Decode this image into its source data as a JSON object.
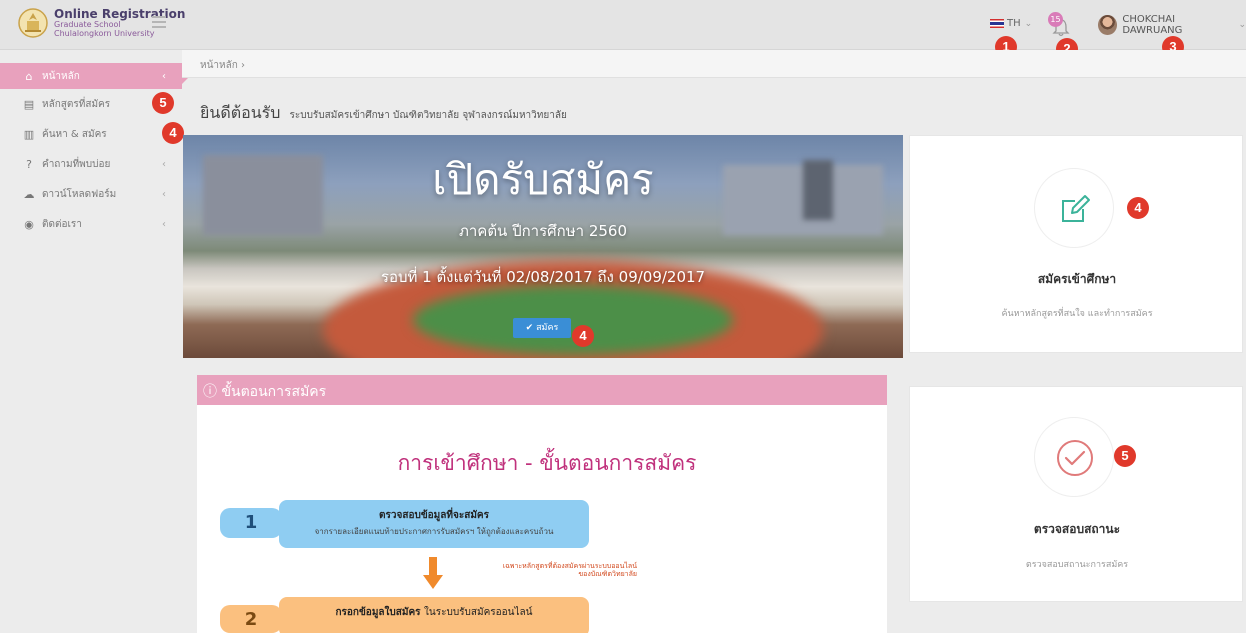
{
  "brand": {
    "title": "Online Registration",
    "sub1": "Graduate School",
    "sub2": "Chulalongkorn University"
  },
  "topbar": {
    "lang": "TH",
    "notif_count": "15",
    "user_name": "CHOKCHAI DAWRUANG"
  },
  "markers": {
    "m1": "1",
    "m2": "2",
    "m3": "3",
    "m4": "4",
    "m5": "5"
  },
  "sidebar": {
    "items": [
      {
        "label": "หน้าหลัก",
        "icon": "home-icon"
      },
      {
        "label": "หลักสูตรที่สมัคร",
        "icon": "course-icon"
      },
      {
        "label": "ค้นหา & สมัคร",
        "icon": "book-icon"
      },
      {
        "label": "คำถามที่พบบ่อย",
        "icon": "question-icon"
      },
      {
        "label": "ดาวน์โหลดฟอร์ม",
        "icon": "cloud-download-icon"
      },
      {
        "label": "ติดต่อเรา",
        "icon": "location-icon"
      }
    ]
  },
  "breadcrumb": {
    "home": "หน้าหลัก"
  },
  "welcome": {
    "title": "ยินดีต้อนรับ",
    "subtitle": "ระบบรับสมัครเข้าศึกษา บัณฑิตวิทยาลัย จุฬาลงกรณ์มหาวิทยาลัย"
  },
  "hero": {
    "title": "เปิดรับสมัคร",
    "semester": "ภาคต้น ปีการศึกษา 2560",
    "round": "รอบที่ 1 ตั้งแต่วันที่ 02/08/2017 ถึง 09/09/2017",
    "apply_button": "สมัคร"
  },
  "steps": {
    "header": "ขั้นตอนการสมัคร",
    "title": "การเข้าศึกษา - ขั้นตอนการสมัคร",
    "step1_num": "1",
    "step1_title": "ตรวจสอบข้อมูลที่จะสมัคร",
    "step1_desc": "จากรายละเอียดแนบท้ายประกาศการรับสมัครฯ ให้ถูกต้องและครบถ้วน",
    "note_line1": "เฉพาะหลักสูตรที่ต้องสมัครผ่านระบบออนไลน์",
    "note_line2": "ของบัณฑิตวิทยาลัย",
    "step2_num": "2",
    "step2_title": "กรอกข้อมูลใบสมัคร",
    "step2_title_rest": "ในระบบรับสมัครออนไลน์"
  },
  "cards": {
    "apply_title": "สมัครเข้าศึกษา",
    "apply_desc": "ค้นหาหลักสูตรที่สนใจ และทำการสมัคร",
    "status_title": "ตรวจสอบสถานะ",
    "status_desc": "ตรวจสอบสถานะการสมัคร"
  },
  "colors": {
    "accent_pink": "#e8a1bd",
    "marker_red": "#e0392b",
    "step1_blue": "#8fcdf2",
    "step2_orange": "#fbc07f"
  }
}
